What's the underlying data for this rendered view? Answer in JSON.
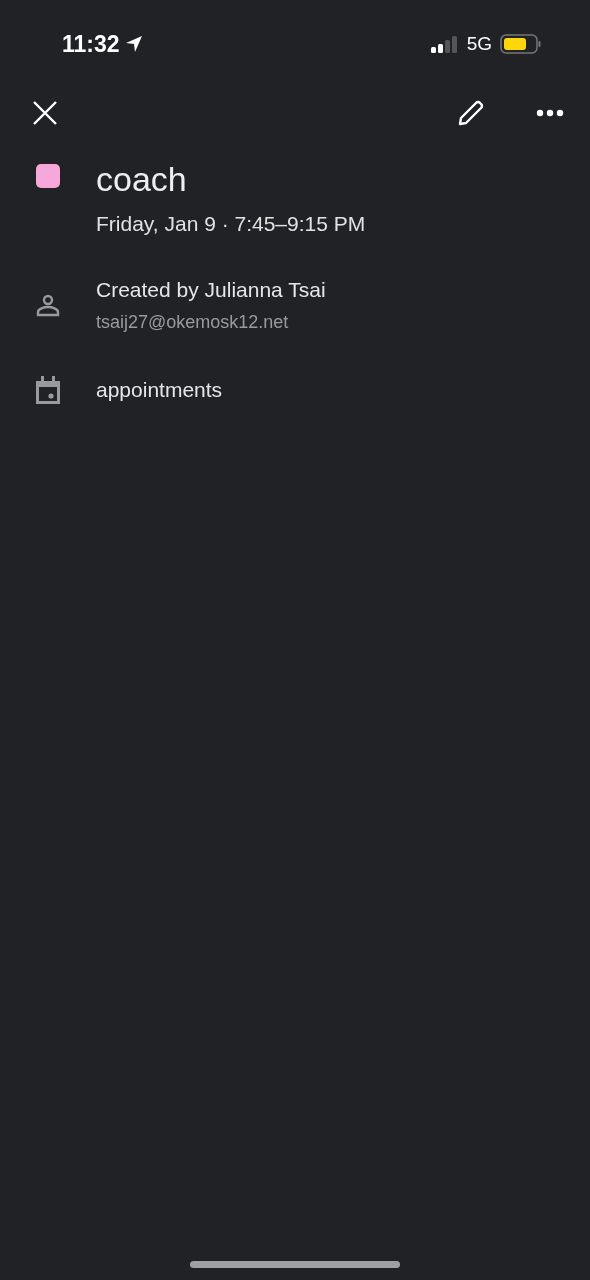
{
  "status_bar": {
    "time": "11:32",
    "network": "5G"
  },
  "event": {
    "title": "coach",
    "color": "#f6a8db",
    "when": "Friday, Jan 9 · 7:45–9:15 PM"
  },
  "details": [
    {
      "kind": "person",
      "text": "Created by Julianna Tsai",
      "subtext": "tsaij27@okemosk12.net"
    },
    {
      "kind": "calendar",
      "text": "appointments"
    }
  ]
}
